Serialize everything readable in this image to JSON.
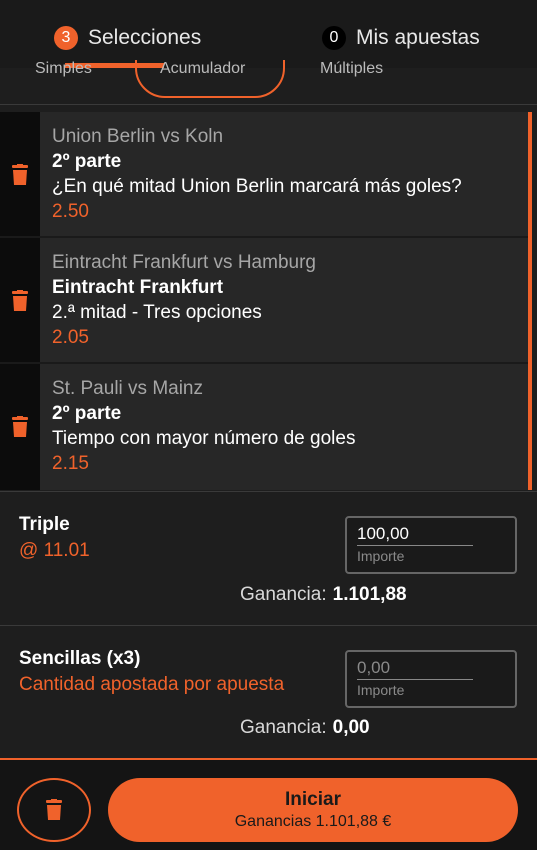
{
  "tabs": {
    "selections": {
      "count": "3",
      "label": "Selecciones"
    },
    "my_bets": {
      "count": "0",
      "label": "Mis apuestas"
    }
  },
  "subtabs": [
    "Simples",
    "Acumulador",
    "Múltiples"
  ],
  "bets": [
    {
      "match": "Union Berlin vs Koln",
      "selection": "2º parte",
      "market": "¿En qué mitad Union Berlin marcará más goles?",
      "odds": "2.50"
    },
    {
      "match": "Eintracht Frankfurt vs Hamburg",
      "selection": "Eintracht Frankfurt",
      "market": "2.ª mitad - Tres opciones",
      "odds": "2.05"
    },
    {
      "match": "St. Pauli vs Mainz",
      "selection": "2º parte",
      "market": "Tiempo con mayor número de goles",
      "odds": "2.15"
    }
  ],
  "triple": {
    "title": "Triple",
    "odds": "@ 11.01",
    "stake_value": "100,00",
    "stake_label": "Importe",
    "gain_label": "Ganancia:",
    "gain_value": "1.101,88"
  },
  "singles": {
    "title": "Sencillas (x3)",
    "subtitle": "Cantidad apostada por apuesta",
    "stake_placeholder": "0,00",
    "stake_label": "Importe",
    "gain_label": "Ganancia:",
    "gain_value": "0,00"
  },
  "footer": {
    "start_label": "Iniciar",
    "start_sub": "Ganancias 1.101,88 €"
  },
  "colors": {
    "accent": "#f0622b",
    "background": "#1e1e1e",
    "card": "#272727"
  },
  "icons": {
    "delete": "trash-icon"
  }
}
